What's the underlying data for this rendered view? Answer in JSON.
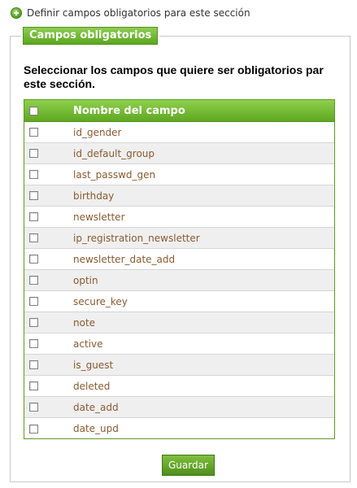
{
  "top_link": {
    "label": "Definir campos obligatorios para este sección"
  },
  "fieldset": {
    "legend": "Campos obligatorios",
    "intro": "Seleccionar los campos que quiere ser obligatorios par este sección."
  },
  "table": {
    "header_label": "Nombre del campo",
    "rows": [
      "id_gender",
      "id_default_group",
      "last_passwd_gen",
      "birthday",
      "newsletter",
      "ip_registration_newsletter",
      "newsletter_date_add",
      "optin",
      "secure_key",
      "note",
      "active",
      "is_guest",
      "deleted",
      "date_add",
      "date_upd"
    ]
  },
  "save_button": {
    "label": "Guardar"
  },
  "colors": {
    "accent": "#5fa822",
    "field_name": "#8a5a2e"
  }
}
